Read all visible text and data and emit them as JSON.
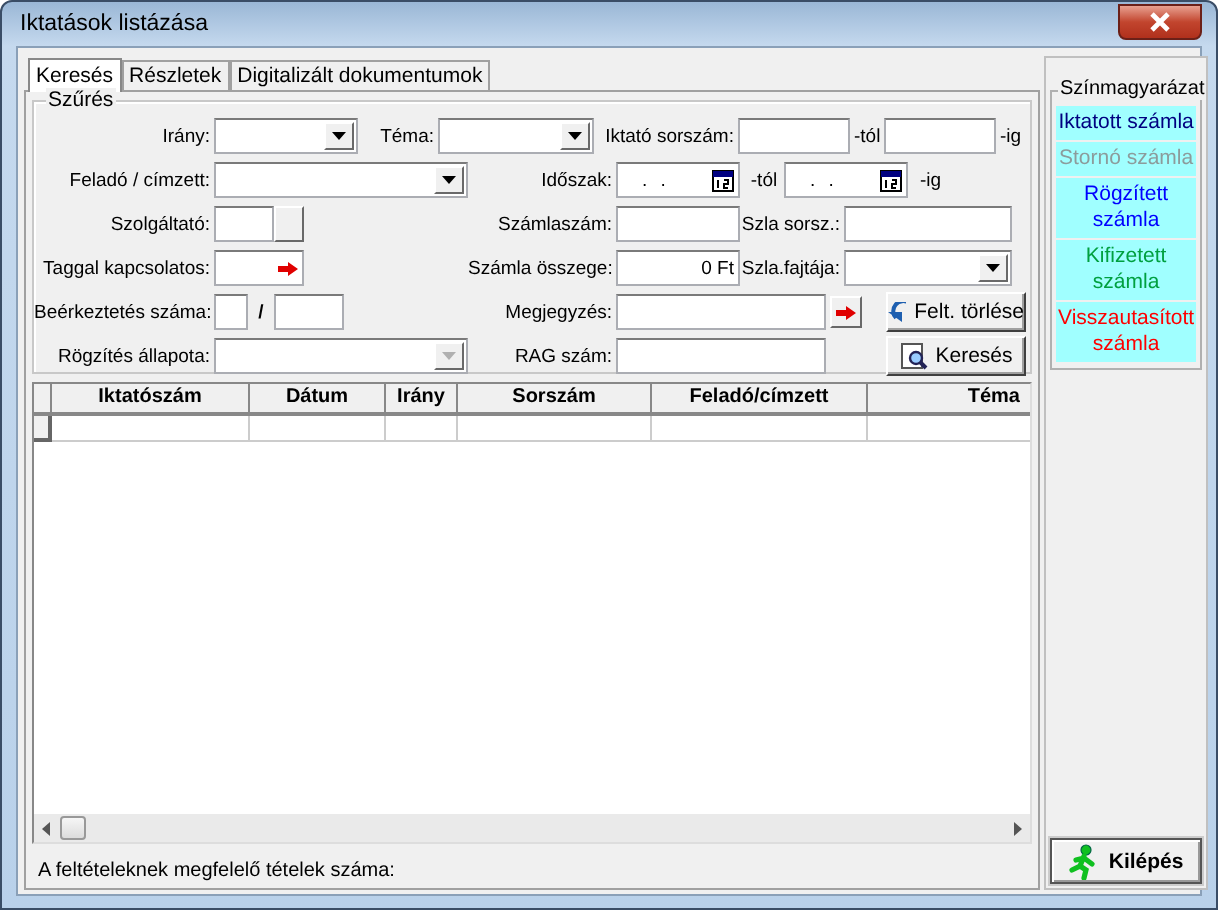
{
  "window": {
    "title": "Iktatások listázása"
  },
  "tabs": [
    {
      "label": "Keresés",
      "selected": true
    },
    {
      "label": "Részletek",
      "selected": false
    },
    {
      "label": "Digitalizált dokumentumok",
      "selected": false
    }
  ],
  "filter": {
    "title": "Szűrés",
    "irany": {
      "label": "Irány:"
    },
    "tema": {
      "label": "Téma:"
    },
    "iktato_sorszam": {
      "label": "Iktató sorszám:",
      "from_suffix": "-tól",
      "to_suffix": "-ig"
    },
    "felado": {
      "label": "Feladó / címzett:"
    },
    "idoszak": {
      "label": "Időszak:",
      "from_value": ". .",
      "from_suffix": "-tól",
      "to_value": ". .",
      "to_suffix": "-ig"
    },
    "szolgaltato": {
      "label": "Szolgáltató:"
    },
    "szamlaszam": {
      "label": "Számlaszám:"
    },
    "szla_sorsz": {
      "label": "Szla sorsz.:"
    },
    "taggal": {
      "label": "Taggal kapcsolatos:"
    },
    "szamla_osszege": {
      "label": "Számla összege:",
      "value": "0 Ft"
    },
    "szla_fajtaja": {
      "label": "Szla.fajtája:"
    },
    "beerkeztetes": {
      "label": "Beérkeztetés száma:",
      "separator": "/"
    },
    "megjegyzes": {
      "label": "Megjegyzés:"
    },
    "rogzites": {
      "label": "Rögzítés állapota:",
      "disabled": true
    },
    "rag": {
      "label": "RAG szám:"
    }
  },
  "buttons": [
    {
      "label": "Felt. törlése",
      "kind": "clear"
    },
    {
      "label": "Keresés",
      "kind": "search"
    }
  ],
  "table": {
    "columns": [
      "Iktatószám",
      "Dátum",
      "Irány",
      "Sorszám",
      "Feladó/címzett",
      "Téma"
    ]
  },
  "status": "A feltételeknek megfelelő tételek száma:",
  "legend": {
    "title": "Színmagyarázat",
    "items": [
      {
        "label": "Iktatott számla",
        "color": "#000080"
      },
      {
        "label": "Stornó számla",
        "color": "#8c9c9c"
      },
      {
        "label": "Rögzített számla",
        "color": "#0000ff"
      },
      {
        "label": "Kifizetett számla",
        "color": "#00a040"
      },
      {
        "label": "Visszautasított számla",
        "color": "#ff0000"
      }
    ]
  },
  "exit_button": {
    "label": "Kilépés"
  }
}
